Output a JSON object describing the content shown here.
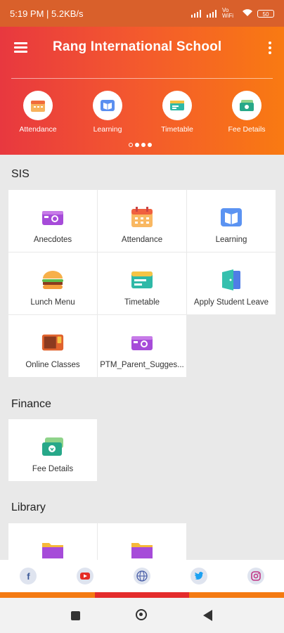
{
  "status_bar": {
    "time": "5:19 PM | 5.2KB/s",
    "network": "Vo WiFi",
    "battery": "50"
  },
  "header": {
    "title": "Rang International School",
    "quick_links": [
      {
        "label": "Attendance",
        "icon": "calendar-icon"
      },
      {
        "label": "Learning",
        "icon": "book-icon"
      },
      {
        "label": "Timetable",
        "icon": "timetable-icon"
      },
      {
        "label": "Fee Details",
        "icon": "money-icon"
      }
    ],
    "carousel_page": 1,
    "carousel_pages": 4
  },
  "sections": [
    {
      "title": "SIS",
      "tiles": [
        {
          "label": "Anecdotes",
          "icon": "camera-icon"
        },
        {
          "label": "Attendance",
          "icon": "calendar-icon"
        },
        {
          "label": "Learning",
          "icon": "book-icon"
        },
        {
          "label": "Lunch Menu",
          "icon": "burger-icon"
        },
        {
          "label": "Timetable",
          "icon": "timetable-icon"
        },
        {
          "label": "Apply Student Leave",
          "icon": "door-icon"
        },
        {
          "label": "Online Classes",
          "icon": "online-class-icon"
        },
        {
          "label": "PTM_Parent_Sugges...",
          "icon": "camera-icon"
        }
      ]
    },
    {
      "title": "Finance",
      "tiles": [
        {
          "label": "Fee Details",
          "icon": "money-icon"
        }
      ]
    },
    {
      "title": "Library",
      "tiles": [
        {
          "label": "",
          "icon": "folder-icon"
        },
        {
          "label": "",
          "icon": "folder-icon"
        }
      ]
    }
  ],
  "social": [
    "facebook-icon",
    "youtube-icon",
    "globe-icon",
    "twitter-icon",
    "instagram-icon"
  ],
  "colors": {
    "accent_start": "#e8383f",
    "accent_end": "#f97a12",
    "status_bar": "#d9602b"
  }
}
